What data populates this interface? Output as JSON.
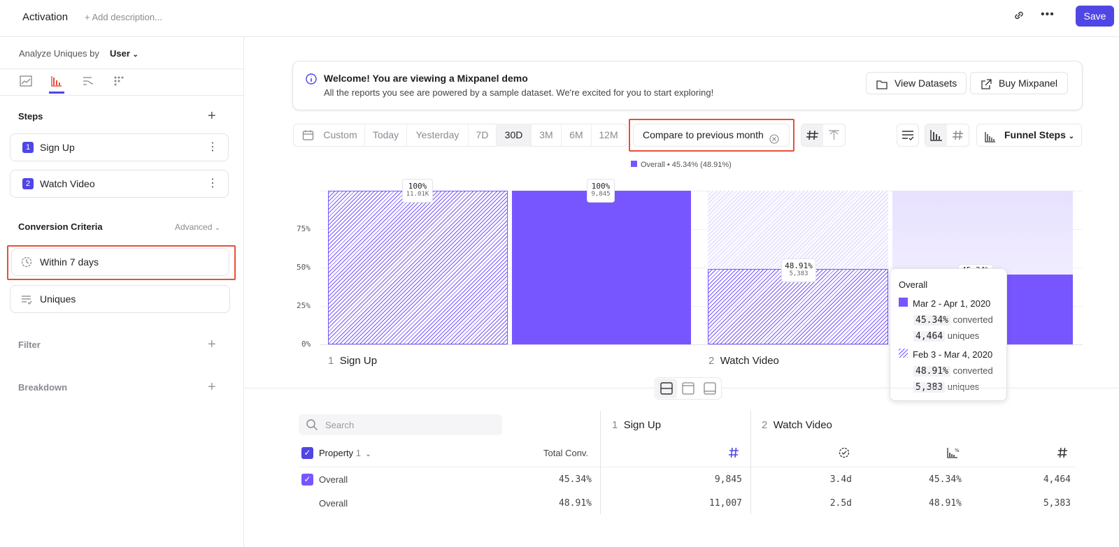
{
  "header": {
    "title": "Activation",
    "add_description": "+ Add description...",
    "save_label": "Save"
  },
  "sidebar": {
    "analyze_label": "Analyze Uniques by",
    "analyze_value": "User",
    "steps_label": "Steps",
    "steps": [
      {
        "num": "1",
        "label": "Sign Up"
      },
      {
        "num": "2",
        "label": "Watch Video"
      }
    ],
    "conversion_label": "Conversion Criteria",
    "advanced_label": "Advanced",
    "window_label": "Within 7 days",
    "counting_label": "Uniques",
    "filter_label": "Filter",
    "breakdown_label": "Breakdown"
  },
  "banner": {
    "title": "Welcome! You are viewing a Mixpanel demo",
    "text": "All the reports you see are powered by a sample dataset. We're excited for you to start exploring!",
    "view_datasets": "View Datasets",
    "buy": "Buy Mixpanel"
  },
  "date_range": {
    "options": [
      "Custom",
      "Today",
      "Yesterday",
      "7D",
      "30D",
      "3M",
      "6M",
      "12M"
    ],
    "selected": "30D",
    "compare_label": "Compare to previous month"
  },
  "toolbar": {
    "funnel_steps": "Funnel Steps"
  },
  "colors": {
    "accent": "#5046e4",
    "bar": "#7856ff",
    "highlight": "#e4513c"
  },
  "chart_data": {
    "type": "bar",
    "legend": "Overall • 45.34% (48.91%)",
    "categories": [
      "Sign Up",
      "Watch Video"
    ],
    "category_nums": [
      "1",
      "2"
    ],
    "series": [
      {
        "name": "Feb 3 - Mar 4, 2020",
        "values": [
          100,
          48.91
        ],
        "value_labels": [
          "100%",
          "48.91%"
        ],
        "count_labels": [
          "11.01K",
          "5,383"
        ]
      },
      {
        "name": "Mar 2 - Apr 1, 2020",
        "values": [
          100,
          45.34
        ],
        "value_labels": [
          "100%",
          "45.34%"
        ],
        "count_labels": [
          "9,845",
          ""
        ]
      }
    ],
    "ylim": [
      0,
      100
    ],
    "yticks": [
      "0%",
      "25%",
      "50%",
      "75%"
    ]
  },
  "tooltip": {
    "title": "Overall",
    "rows": [
      {
        "range": "Mar 2 - Apr 1, 2020",
        "pct": "45.34%",
        "converted": "converted",
        "uniques": "4,464",
        "uniques_label": "uniques"
      },
      {
        "range": "Feb 3 - Mar 4, 2020",
        "pct": "48.91%",
        "converted": "converted",
        "uniques": "5,383",
        "uniques_label": "uniques"
      }
    ]
  },
  "table": {
    "search_placeholder": "Search",
    "property_label": "Property",
    "property_count": "1",
    "total_conv": "Total Conv.",
    "step1_num": "1",
    "step1": "Sign Up",
    "step2_num": "2",
    "step2": "Watch Video",
    "rows": [
      {
        "label": "Overall",
        "total": "45.34%",
        "s1": "9,845",
        "time": "3.4d",
        "pct": "45.34%",
        "count": "4,464"
      },
      {
        "label": "Overall",
        "total": "48.91%",
        "s1": "11,007",
        "time": "2.5d",
        "pct": "48.91%",
        "count": "5,383"
      }
    ]
  }
}
